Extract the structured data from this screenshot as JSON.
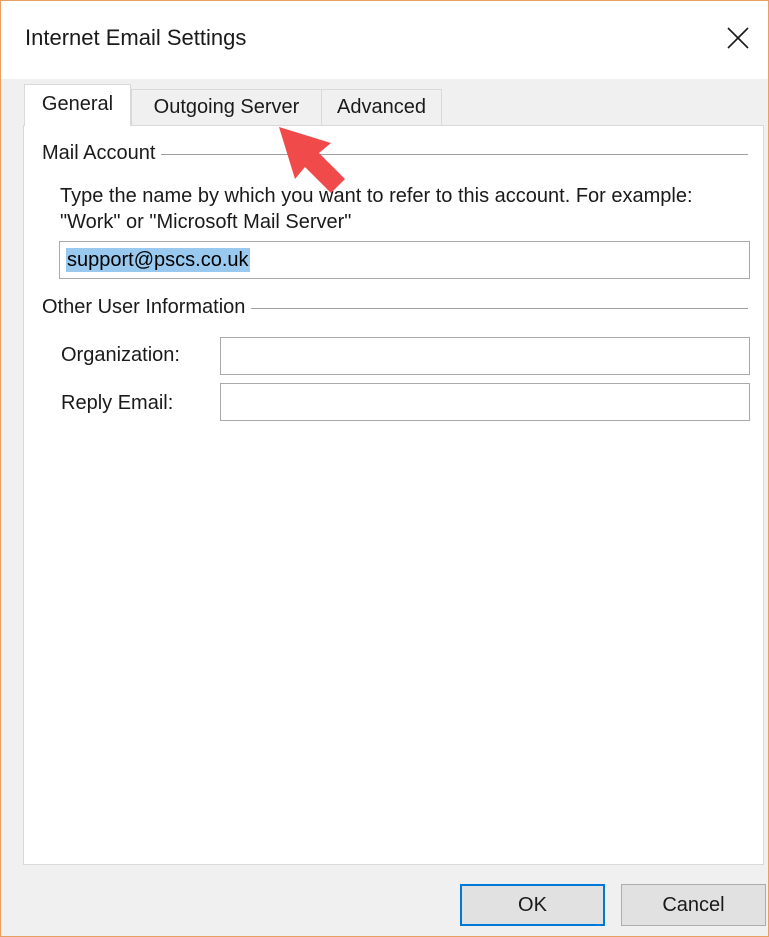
{
  "window": {
    "title": "Internet Email Settings",
    "close_icon": "close-x-icon"
  },
  "tabs": [
    {
      "label": "General",
      "active": true
    },
    {
      "label": "Outgoing Server",
      "active": false
    },
    {
      "label": "Advanced",
      "active": false
    }
  ],
  "mail_account": {
    "group_title": "Mail Account",
    "description": "Type the name by which you want to refer to this account. For example: \"Work\" or \"Microsoft Mail Server\"",
    "account_name_value": "support@pscs.co.uk"
  },
  "other_info": {
    "group_title": "Other User Information",
    "organization_label": "Organization:",
    "organization_value": "",
    "reply_email_label": "Reply Email:",
    "reply_email_value": ""
  },
  "buttons": {
    "ok": "OK",
    "cancel": "Cancel"
  },
  "annotation": {
    "arrow_icon": "red-arrow-pointer-icon",
    "color": "#f04a4a"
  }
}
